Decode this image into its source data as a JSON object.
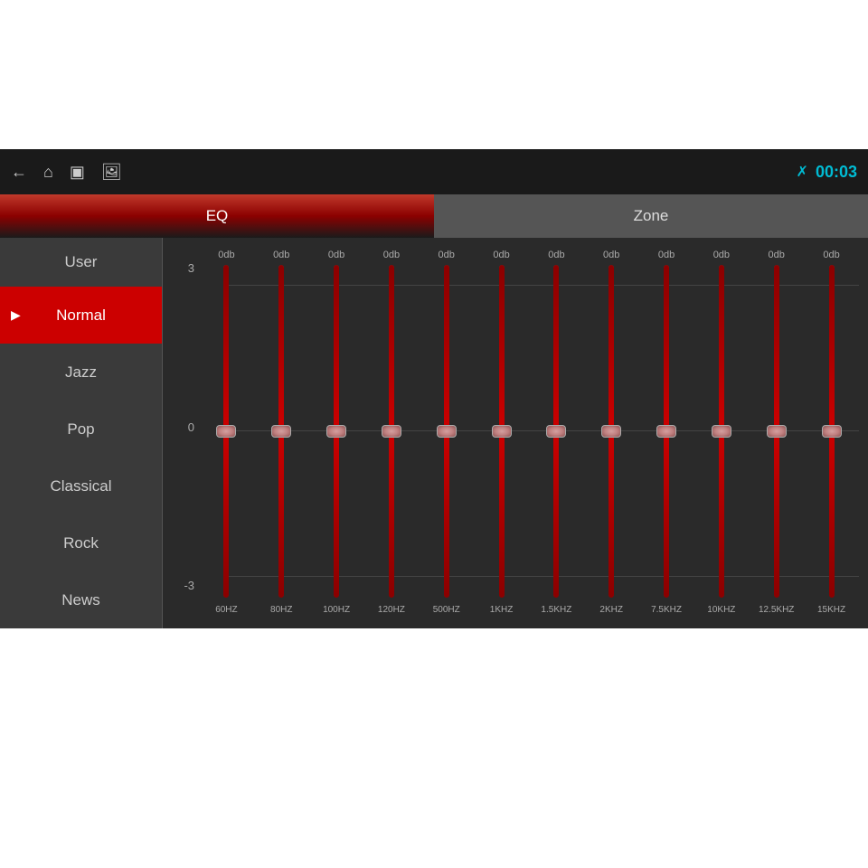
{
  "topbar": {
    "time": "00:03",
    "icons": {
      "back": "←",
      "home": "⌂",
      "window": "▣",
      "image": "🖼"
    }
  },
  "tabs": [
    {
      "id": "eq",
      "label": "EQ",
      "active": true
    },
    {
      "id": "zone",
      "label": "Zone",
      "active": false
    }
  ],
  "sidebar": {
    "items": [
      {
        "id": "user",
        "label": "User",
        "active": false,
        "showArrow": false
      },
      {
        "id": "normal",
        "label": "Normal",
        "active": true,
        "showArrow": true
      },
      {
        "id": "jazz",
        "label": "Jazz",
        "active": false,
        "showArrow": false
      },
      {
        "id": "pop",
        "label": "Pop",
        "active": false,
        "showArrow": false
      },
      {
        "id": "classical",
        "label": "Classical",
        "active": false,
        "showArrow": false
      },
      {
        "id": "rock",
        "label": "Rock",
        "active": false,
        "showArrow": false
      },
      {
        "id": "news",
        "label": "News",
        "active": false,
        "showArrow": false
      }
    ]
  },
  "eq": {
    "db_labels": {
      "top": "3",
      "middle": "0",
      "bottom": "-3"
    },
    "bands": [
      {
        "freq": "60HZ",
        "db": "0db"
      },
      {
        "freq": "80HZ",
        "db": "0db"
      },
      {
        "freq": "100HZ",
        "db": "0db"
      },
      {
        "freq": "120HZ",
        "db": "0db"
      },
      {
        "freq": "500HZ",
        "db": "0db"
      },
      {
        "freq": "1KHZ",
        "db": "0db"
      },
      {
        "freq": "1.5KHZ",
        "db": "0db"
      },
      {
        "freq": "2KHZ",
        "db": "0db"
      },
      {
        "freq": "7.5KHZ",
        "db": "0db"
      },
      {
        "freq": "10KHZ",
        "db": "0db"
      },
      {
        "freq": "12.5KHZ",
        "db": "0db"
      },
      {
        "freq": "15KHZ",
        "db": "0db"
      }
    ]
  }
}
